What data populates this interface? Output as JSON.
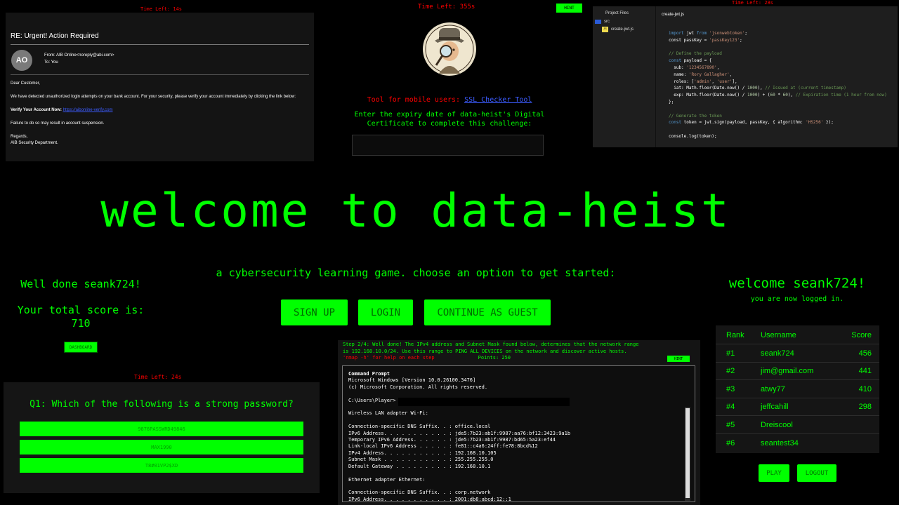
{
  "email": {
    "timer": "Time Left: 14s",
    "subject": "RE: Urgent! Action Required",
    "avatar_initials": "AO",
    "from": "From: AIB Online<noreply@abi.com>",
    "to": "To: You",
    "greeting": "Dear Customer,",
    "message": "We have detected unauthorized login attempts on your bank account. For your security, please verify your account immediately by clicking the link below:",
    "verify_label": "Verify Your Account Now:",
    "verify_link": "https://aibonline-verify.com",
    "warning": "Failure to do so may result in account suspension.",
    "regards": "Regards,",
    "signature": "AIB Security Department."
  },
  "cert_challenge": {
    "timer": "Time Left: 355s",
    "hint_label": "HINT",
    "tool_prefix": "Tool for mobile users:",
    "tool_link": "SSL Checker Tool",
    "prompt_line1": "Enter the expiry date of data-heist's Digital",
    "prompt_line2": "Certificate to complete this challenge:"
  },
  "code_editor": {
    "timer": "Time Left: 28s",
    "project_files_label": "Project Files",
    "folder": "src",
    "file": "create-jwt.js",
    "tab_title": "create-jwt.js"
  },
  "hero": {
    "title": "welcome to data-heist",
    "subtitle": "a cybersecurity learning game. choose an option to get started:",
    "signup_label": "SIGN UP",
    "login_label": "LOGIN",
    "guest_label": "CONTINUE AS GUEST"
  },
  "score": {
    "well_done": "Well done seank724!",
    "total_label": "Your total score is:",
    "total_value": "710",
    "dashboard_label": "DASHBOARD"
  },
  "quiz": {
    "timer": "Time Left: 24s",
    "question": "Q1: Which of the following is a strong password?",
    "options": [
      "9876PASSWRD49846",
      "MAX1990",
      "T8#01VP2$XD"
    ]
  },
  "network": {
    "step_line1": "Step 2/4: Well done! The IPv4 address and Subnet Mask found below, determines that the network range",
    "step_line2": "is 192.168.10.0/24. Use this range to PING ALL DEVICES on the network and discover active hosts.",
    "step_line3": "'nmap -h' for help on each step",
    "points": "Points: 250",
    "hint_label": "HINT",
    "cmd_title": "Command Prompt",
    "cmd_lines": [
      "Microsoft Windows [Version 10.0.26100.3476]",
      "(c) Microsoft Corporation. All rights reserved.",
      "",
      "C:\\Users\\Player>",
      "",
      "Wireless LAN adapter Wi-Fi:",
      "",
      "Connection-specific DNS Suffix. . : office.local",
      "IPv6 Address. . . . . . . . . . . : jde5:7b23:ab1f:9987:aa76:bf12:3423:9a1b",
      "Temporary IPv6 Address. . . . . . : jde5:7b23:ab1f:9987:bd65:5a23:ef44",
      "Link-local IPv6 Address . . . . . : fe81::c4a6:24ff:fe78:8bcd%12",
      "IPv4 Address. . . . . . . . . . . : 192.168.10.105",
      "Subnet Mask . . . . . . . . . . . : 255.255.255.0",
      "Default Gateway . . . . . . . . . : 192.168.10.1",
      "",
      "Ethernet adapter Ethernet:",
      "",
      "Connection-specific DNS Suffix. . : corp.network",
      "IPv6 Address. . . . . . . . . . . : 2001:db8:abcd:12::1"
    ]
  },
  "account": {
    "welcome": "welcome seank724!",
    "logged_in": "you are now logged in.",
    "headers": {
      "rank": "Rank",
      "username": "Username",
      "score": "Score"
    },
    "rows": [
      {
        "rank": "#1",
        "username": "seank724",
        "score": "456"
      },
      {
        "rank": "#2",
        "username": "jim@gmail.com",
        "score": "441"
      },
      {
        "rank": "#3",
        "username": "atwy77",
        "score": "410"
      },
      {
        "rank": "#4",
        "username": "jeffcahill",
        "score": "298"
      },
      {
        "rank": "#5",
        "username": "Dreiscool",
        "score": ""
      },
      {
        "rank": "#6",
        "username": "seantest34",
        "score": ""
      }
    ],
    "play_label": "PLAY",
    "logout_label": "LOGOUT"
  }
}
